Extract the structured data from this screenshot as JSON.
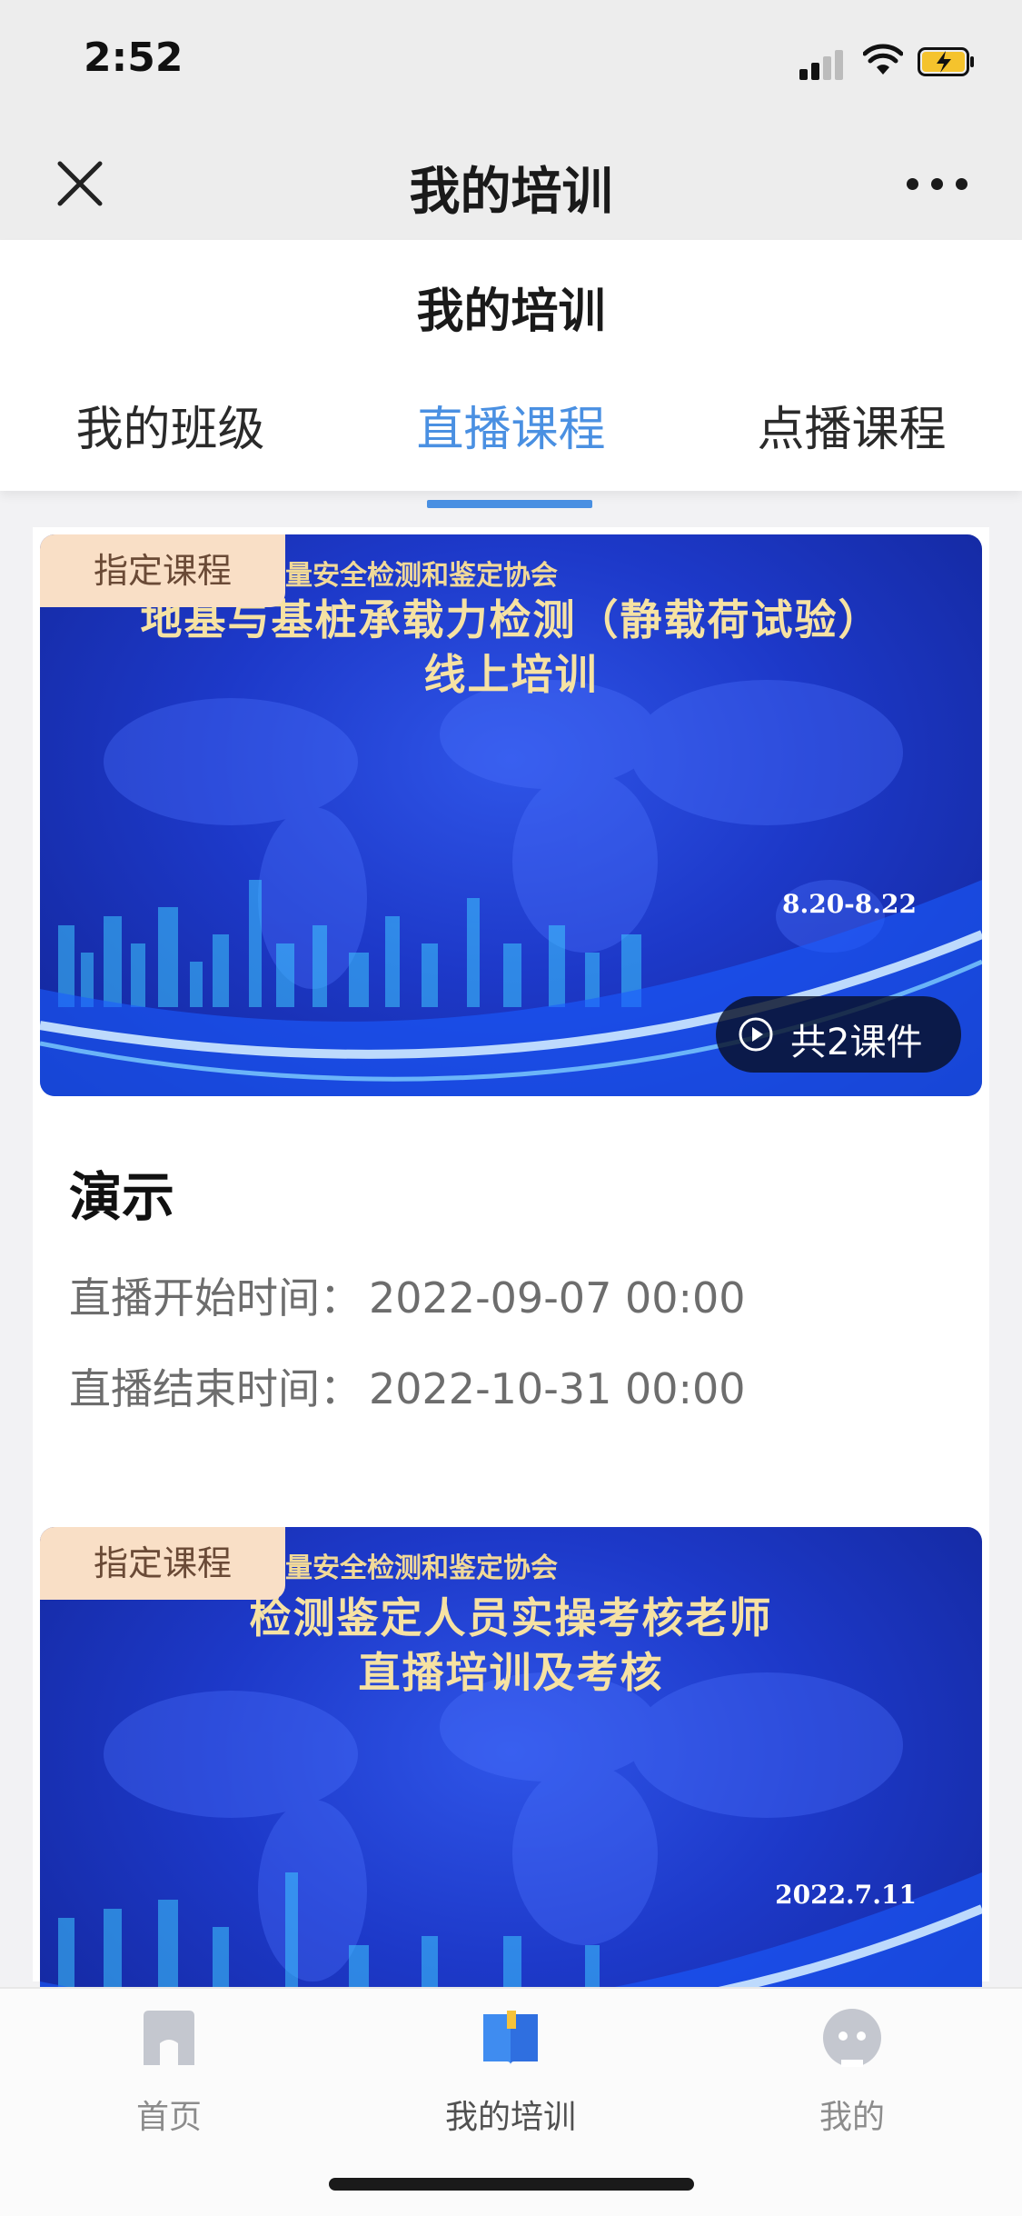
{
  "status_bar": {
    "time": "2:52"
  },
  "nav": {
    "title": "我的培训",
    "close_icon": "close-icon",
    "more_icon": "more-icon"
  },
  "page": {
    "title": "我的培训"
  },
  "tabs": [
    {
      "label": "我的班级",
      "active": false
    },
    {
      "label": "直播课程",
      "active": true
    },
    {
      "label": "点播课程",
      "active": false
    }
  ],
  "courses": [
    {
      "tag": "指定课程",
      "banner": {
        "org": "量安全检测和鉴定协会",
        "line1": "地基与基桩承载力检测（静载荷试验）",
        "line2": "线上培训",
        "date": "8.20-8.22"
      },
      "courseware": "共2课件",
      "name": "演示",
      "start_label": "直播开始时间：",
      "start_value": "2022-09-07 00:00",
      "end_label": "直播结束时间：",
      "end_value": "2022-10-31 00:00"
    },
    {
      "tag": "指定课程",
      "banner": {
        "org": "量安全检测和鉴定协会",
        "line1": "检测鉴定人员实操考核老师",
        "line2": "直播培训及考核",
        "date": "2022.7.11"
      }
    }
  ],
  "tabbar": [
    {
      "label": "首页",
      "icon": "home-icon",
      "active": false
    },
    {
      "label": "我的培训",
      "icon": "book-icon",
      "active": true
    },
    {
      "label": "我的",
      "icon": "profile-icon",
      "active": false
    }
  ],
  "colors": {
    "accent": "#4a90e2",
    "tag_bg": "#f9dfc6",
    "banner_blue": "#1d39c9",
    "banner_gold": "#f6e2a3"
  }
}
